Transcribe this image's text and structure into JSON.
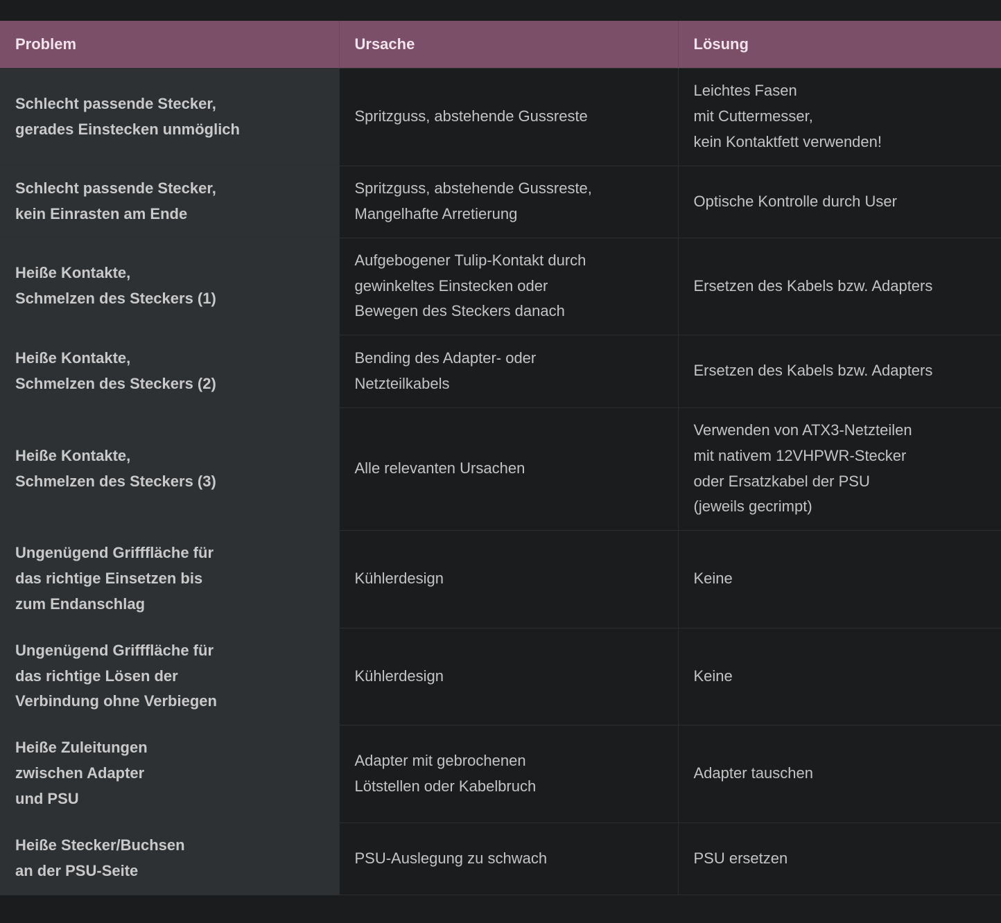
{
  "table": {
    "headers": {
      "problem": "Problem",
      "cause": "Ursache",
      "solution": "Lösung"
    },
    "rows": [
      {
        "problem": [
          "Schlecht passende Stecker,",
          "gerades Einstecken unmöglich"
        ],
        "cause": [
          "Spritzguss, abstehende Gussreste"
        ],
        "solution": [
          "Leichtes Fasen",
          "mit Cuttermesser,",
          "kein Kontaktfett verwenden!"
        ]
      },
      {
        "problem": [
          "Schlecht passende Stecker,",
          "kein Einrasten am Ende"
        ],
        "cause": [
          "Spritzguss, abstehende Gussreste,",
          "Mangelhafte Arretierung"
        ],
        "solution": [
          "Optische Kontrolle durch User"
        ]
      },
      {
        "problem": [
          "Heiße Kontakte,",
          "Schmelzen des Steckers (1)"
        ],
        "cause": [
          "Aufgebogener Tulip-Kontakt durch",
          "gewinkeltes Einstecken oder",
          "Bewegen des Steckers danach"
        ],
        "solution": [
          "Ersetzen des Kabels bzw. Adapters"
        ]
      },
      {
        "problem": [
          "Heiße Kontakte,",
          "Schmelzen des Steckers (2)"
        ],
        "cause": [
          "Bending des Adapter- oder",
          "Netzteilkabels"
        ],
        "solution": [
          "Ersetzen des Kabels bzw. Adapters"
        ]
      },
      {
        "problem": [
          "Heiße Kontakte,",
          "Schmelzen des Steckers (3)"
        ],
        "cause": [
          "Alle relevanten Ursachen"
        ],
        "solution": [
          "Verwenden von ATX3-Netzteilen",
          "mit nativem 12VHPWR-Stecker",
          "oder Ersatzkabel der PSU",
          "(jeweils gecrimpt)"
        ]
      },
      {
        "problem": [
          "Ungenügend Grifffläche für",
          "das richtige Einsetzen bis",
          "zum Endanschlag"
        ],
        "cause": [
          "Kühlerdesign"
        ],
        "solution": [
          "Keine"
        ]
      },
      {
        "problem": [
          "Ungenügend Grifffläche für",
          "das richtige Lösen der",
          "Verbindung ohne Verbiegen"
        ],
        "cause": [
          "Kühlerdesign"
        ],
        "solution": [
          "Keine"
        ]
      },
      {
        "problem": [
          "Heiße Zuleitungen",
          "zwischen Adapter",
          "und PSU"
        ],
        "cause": [
          "Adapter mit gebrochenen",
          "Lötstellen oder Kabelbruch"
        ],
        "solution": [
          "Adapter tauschen"
        ]
      },
      {
        "problem": [
          "Heiße Stecker/Buchsen",
          "an der PSU-Seite"
        ],
        "cause": [
          "PSU-Auslegung zu schwach"
        ],
        "solution": [
          "PSU ersetzen"
        ]
      }
    ]
  }
}
